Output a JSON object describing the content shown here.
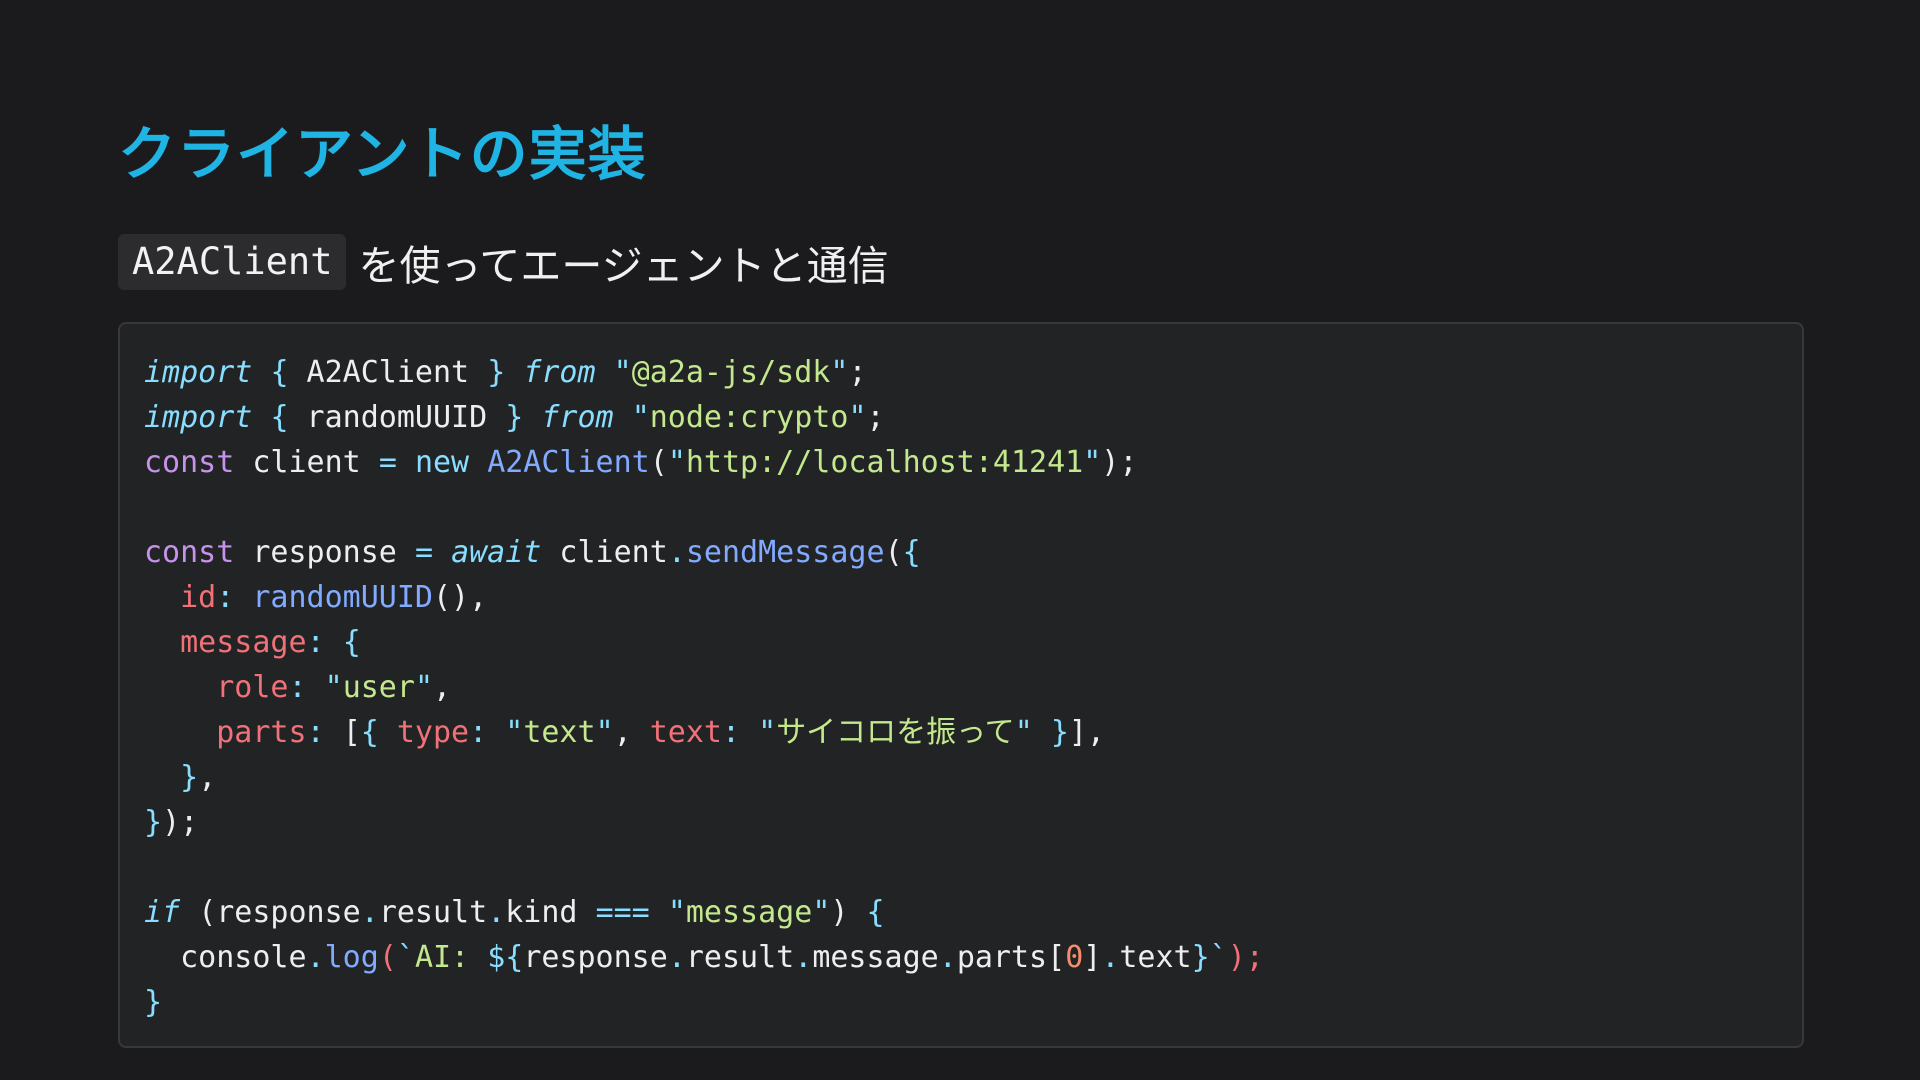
{
  "slide": {
    "title": "クライアントの実装",
    "subtitle_code": "A2AClient",
    "subtitle_text": "を使ってエージェントと通信"
  },
  "code": {
    "lines": [
      [
        [
          "kw-i",
          "import"
        ],
        [
          "tx",
          " "
        ],
        [
          "op",
          "{"
        ],
        [
          "tx",
          " A2AClient "
        ],
        [
          "op",
          "}"
        ],
        [
          "tx",
          " "
        ],
        [
          "kw-i",
          "from"
        ],
        [
          "tx",
          " "
        ],
        [
          "op",
          "\""
        ],
        [
          "str",
          "@a2a-js/sdk"
        ],
        [
          "op",
          "\""
        ],
        [
          "pn",
          ";"
        ]
      ],
      [
        [
          "kw-i",
          "import"
        ],
        [
          "tx",
          " "
        ],
        [
          "op",
          "{"
        ],
        [
          "tx",
          " randomUUID "
        ],
        [
          "op",
          "}"
        ],
        [
          "tx",
          " "
        ],
        [
          "kw-i",
          "from"
        ],
        [
          "tx",
          " "
        ],
        [
          "op",
          "\""
        ],
        [
          "str",
          "node:crypto"
        ],
        [
          "op",
          "\""
        ],
        [
          "pn",
          ";"
        ]
      ],
      [
        [
          "kw",
          "const"
        ],
        [
          "tx",
          " client "
        ],
        [
          "op",
          "="
        ],
        [
          "tx",
          " "
        ],
        [
          "op",
          "new"
        ],
        [
          "tx",
          " "
        ],
        [
          "fn",
          "A2AClient"
        ],
        [
          "pn",
          "("
        ],
        [
          "op",
          "\""
        ],
        [
          "str",
          "http://localhost:41241"
        ],
        [
          "op",
          "\""
        ],
        [
          "pn",
          ");"
        ]
      ],
      [],
      [
        [
          "kw",
          "const"
        ],
        [
          "tx",
          " response "
        ],
        [
          "op",
          "="
        ],
        [
          "tx",
          " "
        ],
        [
          "kw-i",
          "await"
        ],
        [
          "tx",
          " client"
        ],
        [
          "op",
          "."
        ],
        [
          "fn",
          "sendMessage"
        ],
        [
          "pn",
          "("
        ],
        [
          "op",
          "{"
        ]
      ],
      [
        [
          "tx",
          "  "
        ],
        [
          "prop",
          "id"
        ],
        [
          "op",
          ":"
        ],
        [
          "tx",
          " "
        ],
        [
          "fn",
          "randomUUID"
        ],
        [
          "pn",
          "(),"
        ]
      ],
      [
        [
          "tx",
          "  "
        ],
        [
          "prop",
          "message"
        ],
        [
          "op",
          ":"
        ],
        [
          "tx",
          " "
        ],
        [
          "op",
          "{"
        ]
      ],
      [
        [
          "tx",
          "    "
        ],
        [
          "prop",
          "role"
        ],
        [
          "op",
          ":"
        ],
        [
          "tx",
          " "
        ],
        [
          "op",
          "\""
        ],
        [
          "str",
          "user"
        ],
        [
          "op",
          "\""
        ],
        [
          "pn",
          ","
        ]
      ],
      [
        [
          "tx",
          "    "
        ],
        [
          "prop",
          "parts"
        ],
        [
          "op",
          ":"
        ],
        [
          "tx",
          " "
        ],
        [
          "pn",
          "["
        ],
        [
          "op",
          "{"
        ],
        [
          "tx",
          " "
        ],
        [
          "prop",
          "type"
        ],
        [
          "op",
          ":"
        ],
        [
          "tx",
          " "
        ],
        [
          "op",
          "\""
        ],
        [
          "str",
          "text"
        ],
        [
          "op",
          "\""
        ],
        [
          "pn",
          ","
        ],
        [
          "tx",
          " "
        ],
        [
          "prop",
          "text"
        ],
        [
          "op",
          ":"
        ],
        [
          "tx",
          " "
        ],
        [
          "op",
          "\""
        ],
        [
          "str",
          "サイコロを振って"
        ],
        [
          "op",
          "\""
        ],
        [
          "tx",
          " "
        ],
        [
          "op",
          "}"
        ],
        [
          "pn",
          "],"
        ]
      ],
      [
        [
          "tx",
          "  "
        ],
        [
          "op",
          "}"
        ],
        [
          "pn",
          ","
        ]
      ],
      [
        [
          "op",
          "}"
        ],
        [
          "pn",
          ");"
        ]
      ],
      [],
      [
        [
          "kw-i",
          "if"
        ],
        [
          "tx",
          " "
        ],
        [
          "pn",
          "("
        ],
        [
          "tx",
          "response"
        ],
        [
          "op",
          "."
        ],
        [
          "tx",
          "result"
        ],
        [
          "op",
          "."
        ],
        [
          "tx",
          "kind "
        ],
        [
          "op",
          "==="
        ],
        [
          "tx",
          " "
        ],
        [
          "op",
          "\""
        ],
        [
          "str",
          "message"
        ],
        [
          "op",
          "\""
        ],
        [
          "pn",
          ")"
        ],
        [
          "tx",
          " "
        ],
        [
          "op",
          "{"
        ]
      ],
      [
        [
          "tx",
          "  console"
        ],
        [
          "op",
          "."
        ],
        [
          "fn",
          "log"
        ],
        [
          "prop",
          "("
        ],
        [
          "op",
          "`"
        ],
        [
          "str",
          "AI: "
        ],
        [
          "op",
          "${"
        ],
        [
          "tx",
          "response"
        ],
        [
          "op",
          "."
        ],
        [
          "tx",
          "result"
        ],
        [
          "op",
          "."
        ],
        [
          "tx",
          "message"
        ],
        [
          "op",
          "."
        ],
        [
          "tx",
          "parts"
        ],
        [
          "pn",
          "["
        ],
        [
          "num",
          "0"
        ],
        [
          "pn",
          "]"
        ],
        [
          "op",
          "."
        ],
        [
          "tx",
          "text"
        ],
        [
          "op",
          "}`"
        ],
        [
          "prop",
          ");"
        ]
      ],
      [
        [
          "op",
          "}"
        ]
      ]
    ]
  }
}
